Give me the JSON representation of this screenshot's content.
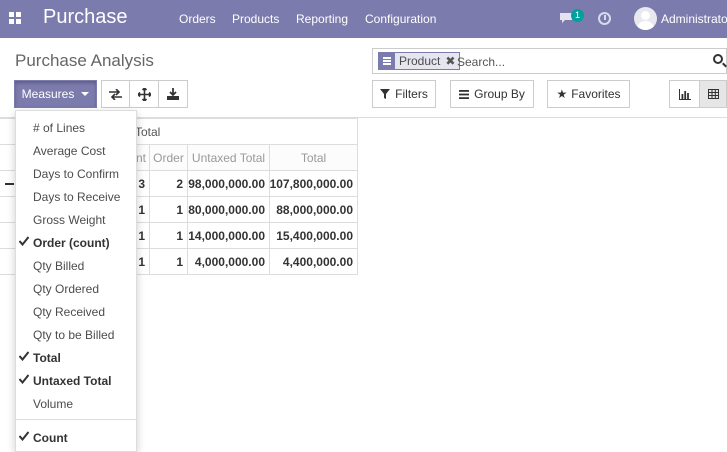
{
  "navbar": {
    "app_name": "Purchase",
    "menu": [
      "Orders",
      "Products",
      "Reporting",
      "Configuration"
    ],
    "chat_count": "1",
    "user_name": "Administrator"
  },
  "control_panel": {
    "title": "Purchase Analysis",
    "search": {
      "facet_label": "Product",
      "placeholder": "Search..."
    },
    "measures_label": "Measures",
    "filters_label": "Filters",
    "groupby_label": "Group By",
    "favorites_label": "Favorites"
  },
  "pivot": {
    "header_top": "Total",
    "col_headers": [
      "nt",
      "Order",
      "Untaxed Total",
      "Total"
    ],
    "rows": [
      {
        "label": "",
        "values": [
          "3",
          "2",
          "98,000,000.00",
          "107,800,000.00"
        ]
      },
      {
        "label": "",
        "values": [
          "1",
          "1",
          "80,000,000.00",
          "88,000,000.00"
        ]
      },
      {
        "label": "",
        "values": [
          "1",
          "1",
          "14,000,000.00",
          "15,400,000.00"
        ]
      },
      {
        "label": "",
        "values": [
          "1",
          "1",
          "4,000,000.00",
          "4,400,000.00"
        ]
      }
    ]
  },
  "measures_menu": {
    "items": [
      {
        "label": "# of Lines",
        "checked": false
      },
      {
        "label": "Average Cost",
        "checked": false
      },
      {
        "label": "Days to Confirm",
        "checked": false
      },
      {
        "label": "Days to Receive",
        "checked": false
      },
      {
        "label": "Gross Weight",
        "checked": false
      },
      {
        "label": "Order (count)",
        "checked": true
      },
      {
        "label": "Qty Billed",
        "checked": false
      },
      {
        "label": "Qty Ordered",
        "checked": false
      },
      {
        "label": "Qty Received",
        "checked": false
      },
      {
        "label": "Qty to be Billed",
        "checked": false
      },
      {
        "label": "Total",
        "checked": true
      },
      {
        "label": "Untaxed Total",
        "checked": true
      },
      {
        "label": "Volume",
        "checked": false
      }
    ],
    "count_item": {
      "label": "Count",
      "checked": true
    }
  },
  "colors": {
    "brand": "#7c7bad",
    "badge": "#00a09d"
  }
}
